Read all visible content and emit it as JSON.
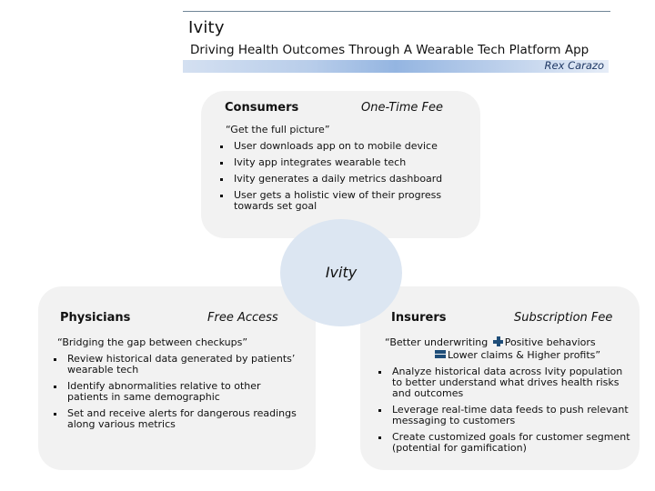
{
  "header": {
    "title": "Ivity",
    "subtitle": "Driving Health Outcomes Through A Wearable Tech Platform App",
    "author": "Rex Carazo"
  },
  "hub": {
    "label": "Ivity",
    "color": "#dce6f2"
  },
  "consumers": {
    "heading": "Consumers",
    "fee": "One-Time Fee",
    "quote": "“Get the full picture”",
    "bullets": [
      "User downloads app on to mobile device",
      "Ivity app integrates wearable tech",
      "Ivity generates a daily metrics dashboard",
      "User gets a holistic view of their progress towards set goal"
    ]
  },
  "physicians": {
    "heading": "Physicians",
    "fee": "Free Access",
    "quote": "“Bridging the gap between checkups”",
    "bullets": [
      "Review historical data generated by patients’ wearable tech",
      "Identify abnormalities relative to other patients in same demographic",
      "Set and receive alerts for dangerous readings along various metrics"
    ]
  },
  "insurers": {
    "heading": "Insurers",
    "fee": "Subscription Fee",
    "quote_part1": "“Better underwriting",
    "quote_part2": "Positive behaviors",
    "quote_part3": "Lower claims & Higher profits”",
    "plus_icon": "plus-icon",
    "equals_icon": "equals-icon",
    "bullets": [
      "Analyze historical data across Ivity population to better understand what drives health risks and outcomes",
      "Leverage real-time data feeds to push relevant messaging to customers",
      "Create customized goals for customer segment (potential for gamification)"
    ]
  },
  "colors": {
    "box_fill": "#f2f2f2",
    "accent_dark": "#1f4e79",
    "author_text": "#1f3864"
  }
}
